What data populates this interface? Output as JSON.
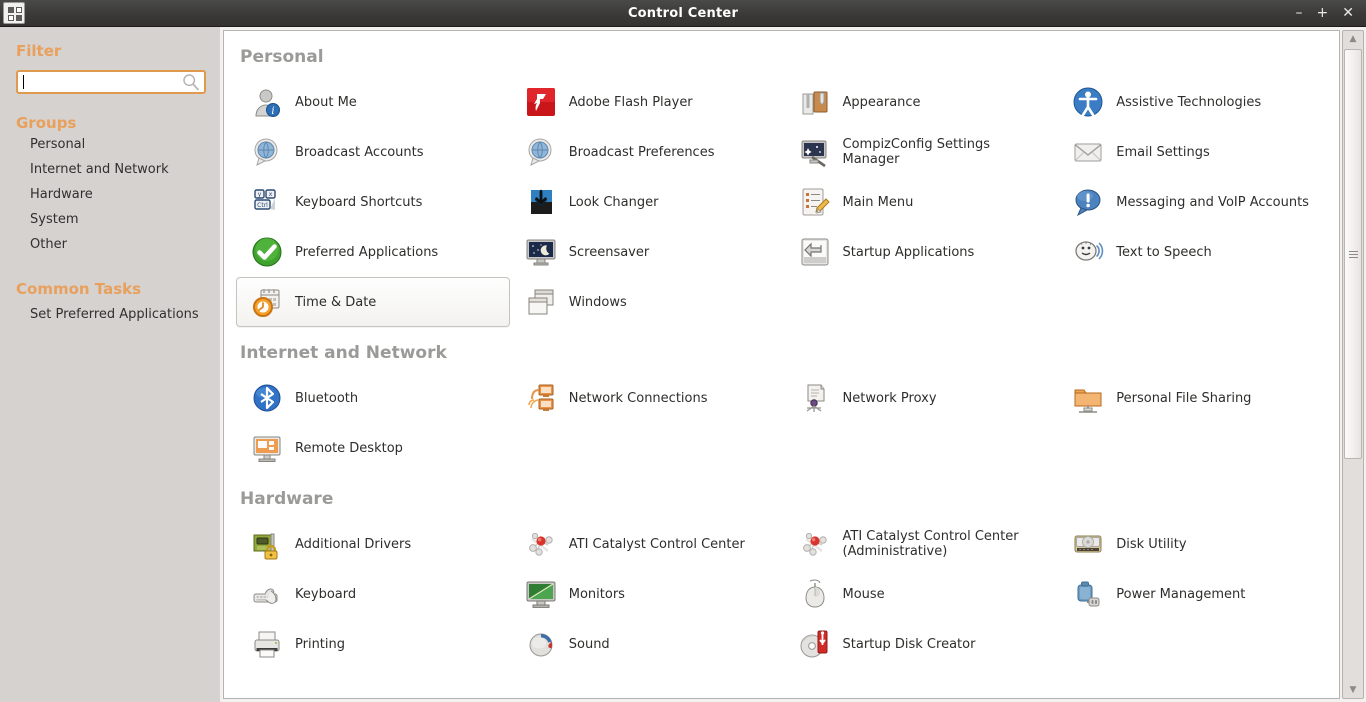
{
  "window": {
    "title": "Control Center",
    "icon": "grid-squares-icon",
    "buttons": {
      "minimize": "–",
      "maximize": "+",
      "close": "✕"
    }
  },
  "sidebar": {
    "filter_heading": "Filter",
    "filter": {
      "value": "",
      "placeholder": ""
    },
    "groups_heading": "Groups",
    "groups": [
      {
        "label": "Personal"
      },
      {
        "label": "Internet and Network"
      },
      {
        "label": "Hardware"
      },
      {
        "label": "System"
      },
      {
        "label": "Other"
      }
    ],
    "common_tasks_heading": "Common Tasks",
    "common_tasks": [
      {
        "label": "Set Preferred Applications"
      }
    ]
  },
  "content": {
    "sections": [
      {
        "title": "Personal",
        "items": [
          {
            "label": "About Me",
            "icon": "user-info-icon",
            "selected": false
          },
          {
            "label": "Adobe Flash Player",
            "icon": "flash-player-icon",
            "selected": false
          },
          {
            "label": "Appearance",
            "icon": "appearance-icon",
            "selected": false
          },
          {
            "label": "Assistive Technologies",
            "icon": "accessibility-icon",
            "selected": false
          },
          {
            "label": "Broadcast Accounts",
            "icon": "globe-bubble-icon",
            "selected": false
          },
          {
            "label": "Broadcast Preferences",
            "icon": "globe-bubble-icon",
            "selected": false
          },
          {
            "label": "CompizConfig Settings Manager",
            "icon": "monitor-wand-icon",
            "selected": false
          },
          {
            "label": "Email Settings",
            "icon": "envelope-icon",
            "selected": false
          },
          {
            "label": "Keyboard Shortcuts",
            "icon": "keycaps-icon",
            "selected": false
          },
          {
            "label": "Look Changer",
            "icon": "download-screen-icon",
            "selected": false
          },
          {
            "label": "Main Menu",
            "icon": "checklist-pencil-icon",
            "selected": false
          },
          {
            "label": "Messaging and VoIP Accounts",
            "icon": "chat-exclaim-icon",
            "selected": false
          },
          {
            "label": "Preferred Applications",
            "icon": "green-check-icon",
            "selected": false
          },
          {
            "label": "Screensaver",
            "icon": "moon-monitor-icon",
            "selected": false
          },
          {
            "label": "Startup Applications",
            "icon": "startup-arrow-icon",
            "selected": false
          },
          {
            "label": "Text to Speech",
            "icon": "speech-face-icon",
            "selected": false
          },
          {
            "label": "Time & Date",
            "icon": "clock-calendar-icon",
            "selected": true
          },
          {
            "label": "Windows",
            "icon": "windows-stack-icon",
            "selected": false
          }
        ]
      },
      {
        "title": "Internet and Network",
        "items": [
          {
            "label": "Bluetooth",
            "icon": "bluetooth-icon",
            "selected": false
          },
          {
            "label": "Network Connections",
            "icon": "network-computers-icon",
            "selected": false
          },
          {
            "label": "Network Proxy",
            "icon": "proxy-scroll-icon",
            "selected": false
          },
          {
            "label": "Personal File Sharing",
            "icon": "shared-folder-icon",
            "selected": false
          },
          {
            "label": "Remote Desktop",
            "icon": "remote-desktop-icon",
            "selected": false
          }
        ]
      },
      {
        "title": "Hardware",
        "items": [
          {
            "label": "Additional Drivers",
            "icon": "circuit-board-lock-icon",
            "selected": false
          },
          {
            "label": "ATI Catalyst Control Center",
            "icon": "molecule-icon",
            "selected": false
          },
          {
            "label": "ATI Catalyst Control Center (Administrative)",
            "icon": "molecule-icon",
            "selected": false
          },
          {
            "label": "Disk Utility",
            "icon": "hard-disk-icon",
            "selected": false
          },
          {
            "label": "Keyboard",
            "icon": "keyboard-hand-icon",
            "selected": false
          },
          {
            "label": "Monitors",
            "icon": "monitor-icon",
            "selected": false
          },
          {
            "label": "Mouse",
            "icon": "mouse-icon",
            "selected": false
          },
          {
            "label": "Power Management",
            "icon": "battery-plug-icon",
            "selected": false
          },
          {
            "label": "Printing",
            "icon": "printer-icon",
            "selected": false
          },
          {
            "label": "Sound",
            "icon": "sound-icon",
            "selected": false
          },
          {
            "label": "Startup Disk Creator",
            "icon": "usb-disc-icon",
            "selected": false
          }
        ]
      }
    ]
  },
  "scrollbar": {
    "up_arrow": "▲",
    "down_arrow": "▼"
  },
  "colors": {
    "accent_orange": "#e8a05c",
    "section_heading_gray": "#9a9a98",
    "sidebar_bg": "#d6d2d0",
    "titlebar_bg": "#3c3b39"
  }
}
